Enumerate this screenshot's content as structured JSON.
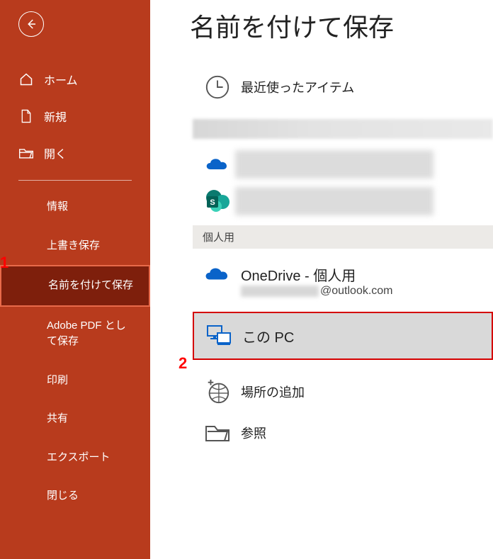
{
  "annotations": {
    "one": "1",
    "two": "2"
  },
  "sidebar": {
    "back": "←",
    "home": "ホーム",
    "new": "新規",
    "open": "開く",
    "info": "情報",
    "save": "上書き保存",
    "saveas": "名前を付けて保存",
    "adobepdf": "Adobe PDF として保存",
    "print": "印刷",
    "share": "共有",
    "export": "エクスポート",
    "close": "閉じる"
  },
  "main": {
    "title": "名前を付けて保存",
    "recent": "最近使ったアイテム",
    "personal_header": "個人用",
    "onedrive_title": "OneDrive - 個人用",
    "onedrive_email_suffix": "@outlook.com",
    "thispc": "この PC",
    "addplace": "場所の追加",
    "browse": "参照"
  }
}
